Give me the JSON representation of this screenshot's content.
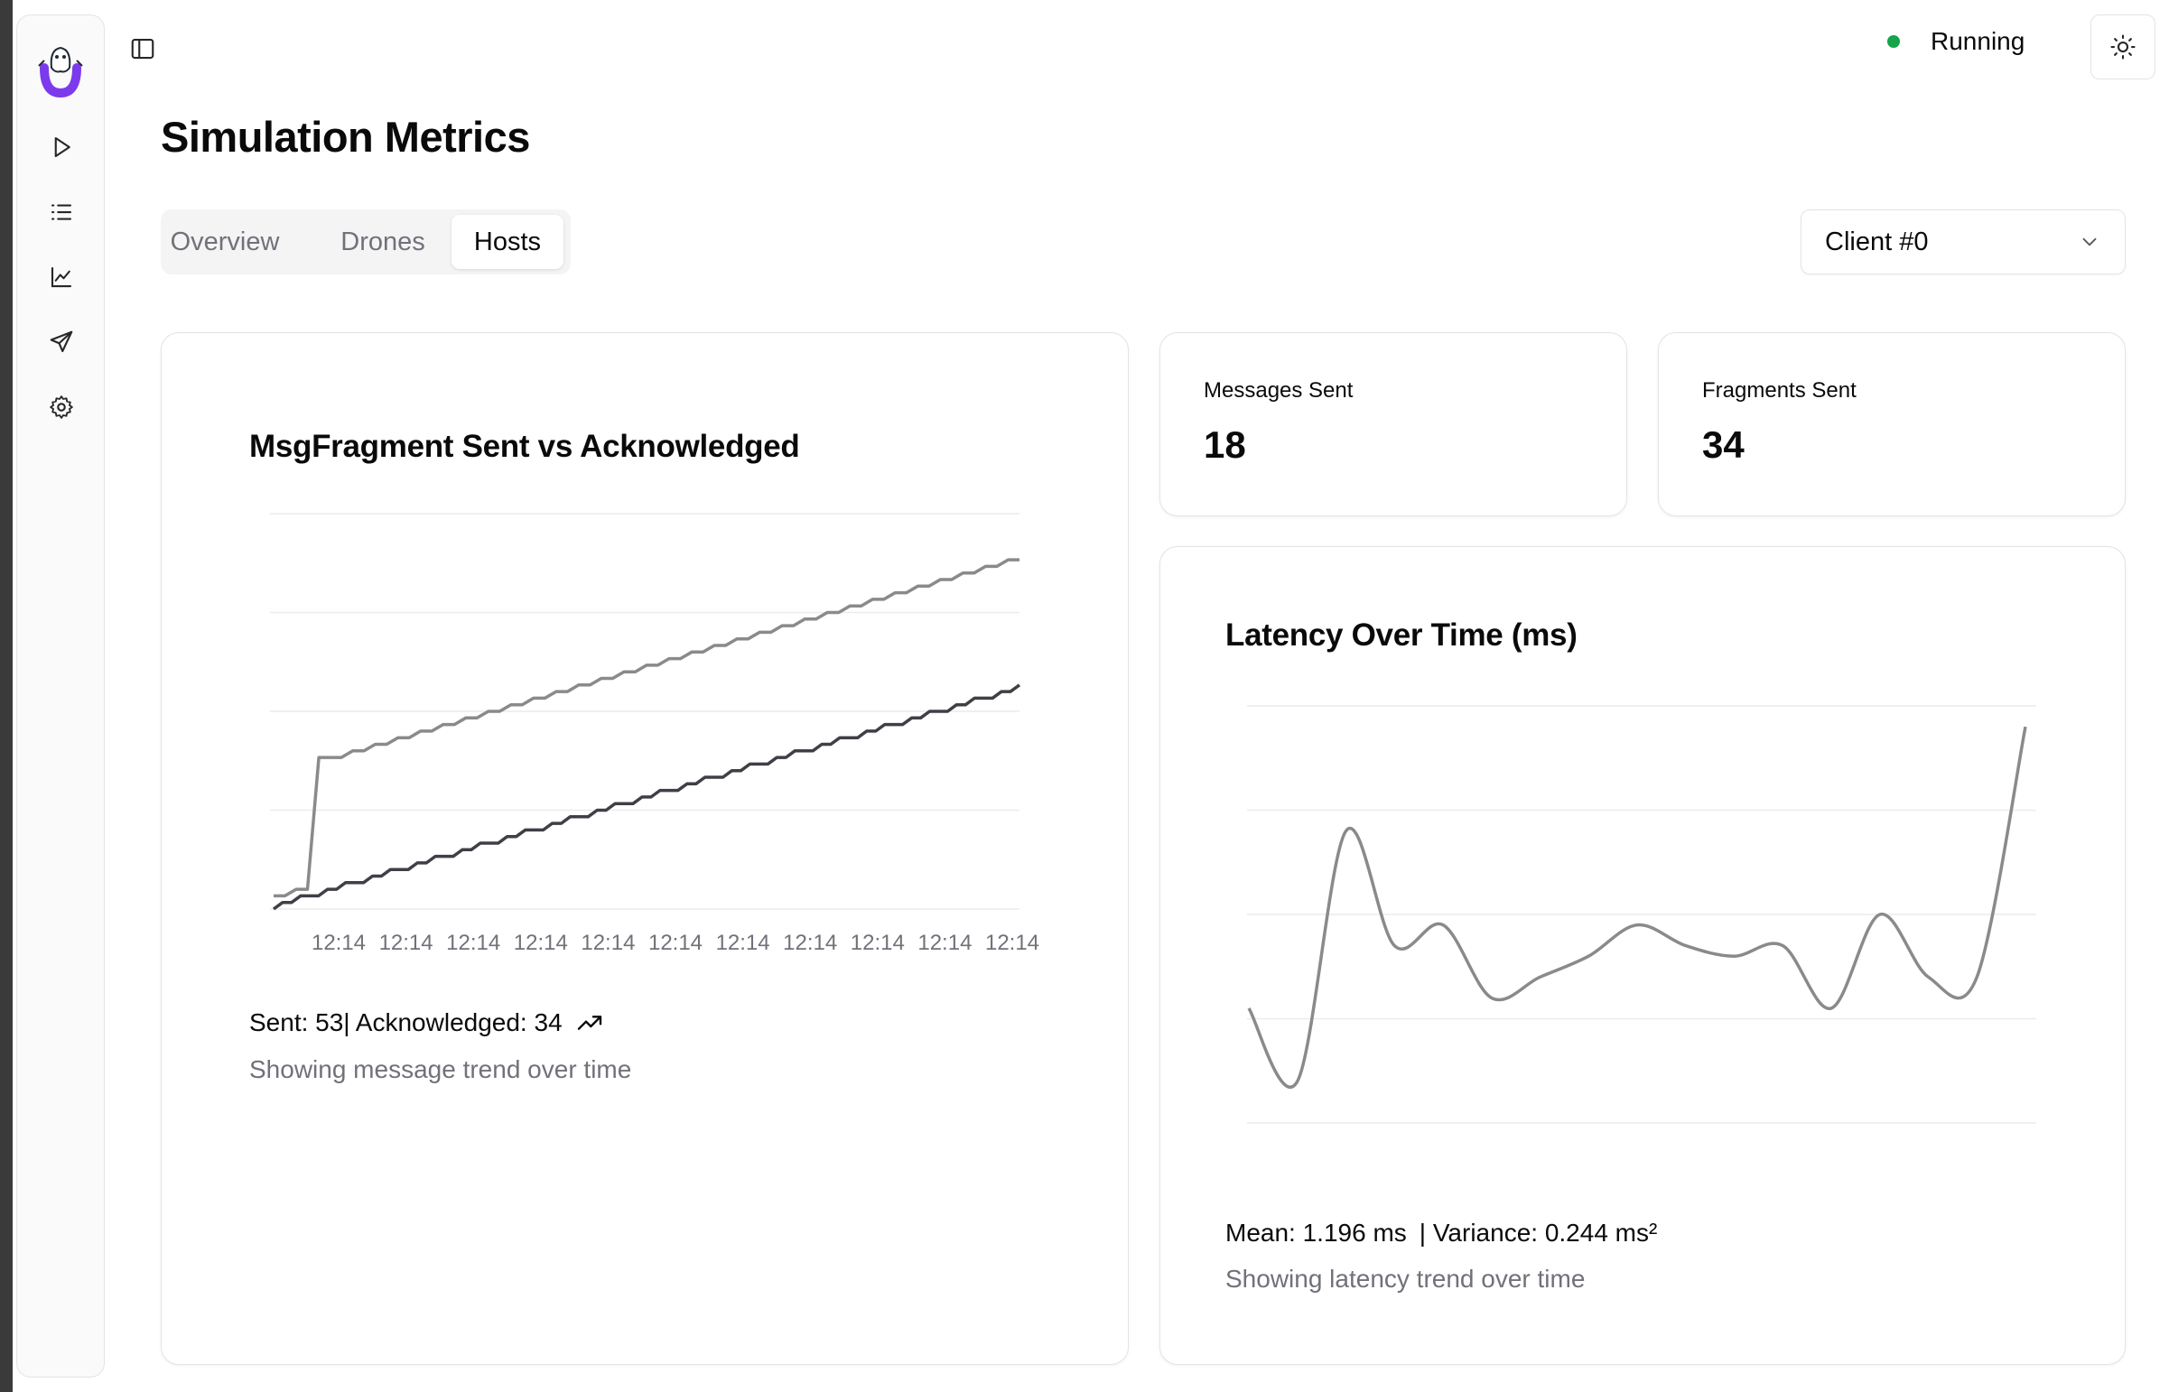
{
  "header": {
    "status_label": "Running",
    "status_color": "#16a34a"
  },
  "sidebar": {
    "icons": [
      "play-icon",
      "list-icon",
      "chart-line-icon",
      "send-icon",
      "gear-icon"
    ]
  },
  "page": {
    "title": "Simulation Metrics"
  },
  "tabs": [
    {
      "label": "Overview",
      "active": false
    },
    {
      "label": "Drones",
      "active": false
    },
    {
      "label": "Hosts",
      "active": true
    }
  ],
  "client_select": {
    "value": "Client #0"
  },
  "stats": {
    "messages_sent": {
      "label": "Messages Sent",
      "value": "18"
    },
    "fragments_sent": {
      "label": "Fragments Sent",
      "value": "34"
    }
  },
  "fragment_chart": {
    "title": "MsgFragment Sent vs Acknowledged",
    "summary": "Sent: 53| Acknowledged: 34",
    "subtitle": "Showing message trend over time",
    "tick_labels": [
      "12:14",
      "12:14",
      "12:14",
      "12:14",
      "12:14",
      "12:14",
      "12:14",
      "12:14",
      "12:14",
      "12:14",
      "12:14"
    ]
  },
  "latency_chart": {
    "title": "Latency Over Time (ms)",
    "mean_text": "Mean: 1.196 ms",
    "variance_text": "| Variance: 0.244 ms²",
    "subtitle": "Showing latency trend over time"
  },
  "chart_data": [
    {
      "type": "line",
      "title": "MsgFragment Sent vs Acknowledged",
      "categories": [
        "12:14",
        "12:14",
        "12:14",
        "12:14",
        "12:14",
        "12:14",
        "12:14",
        "12:14",
        "12:14",
        "12:14",
        "12:14"
      ],
      "grid": true,
      "ylim": [
        0,
        60
      ],
      "series": [
        {
          "name": "Sent",
          "color": "#8a8a8a",
          "values": [
            2,
            2,
            3,
            3,
            23,
            23,
            23,
            24,
            24,
            25,
            25,
            26,
            26,
            27,
            27,
            28,
            28,
            29,
            29,
            30,
            30,
            31,
            31,
            32,
            32,
            33,
            33,
            34,
            34,
            35,
            35,
            36,
            36,
            37,
            37,
            38,
            38,
            39,
            39,
            40,
            40,
            41,
            41,
            42,
            42,
            43,
            43,
            44,
            44,
            45,
            45,
            46,
            46,
            47,
            47,
            48,
            48,
            49,
            49,
            50,
            50,
            51,
            51,
            52,
            52,
            53,
            53
          ]
        },
        {
          "name": "Acknowledged",
          "color": "#3f3f46",
          "values": [
            0,
            1,
            1,
            2,
            2,
            2,
            3,
            3,
            4,
            4,
            4,
            5,
            5,
            6,
            6,
            6,
            7,
            7,
            8,
            8,
            8,
            9,
            9,
            10,
            10,
            10,
            11,
            11,
            12,
            12,
            12,
            13,
            13,
            14,
            14,
            14,
            15,
            15,
            16,
            16,
            16,
            17,
            17,
            18,
            18,
            18,
            19,
            19,
            20,
            20,
            20,
            21,
            21,
            22,
            22,
            22,
            23,
            23,
            24,
            24,
            24,
            25,
            25,
            26,
            26,
            26,
            27,
            27,
            28,
            28,
            28,
            29,
            29,
            30,
            30,
            30,
            31,
            31,
            32,
            32,
            32,
            33,
            33,
            34
          ]
        }
      ]
    },
    {
      "type": "line",
      "title": "Latency Over Time (ms)",
      "grid": true,
      "ylim": [
        0,
        4
      ],
      "series": [
        {
          "name": "Latency",
          "color": "#8a8a8a",
          "values": [
            1.1,
            0.4,
            2.8,
            1.7,
            1.9,
            1.2,
            1.4,
            1.6,
            1.9,
            1.7,
            1.6,
            1.7,
            1.1,
            2.0,
            1.4,
            1.4,
            3.8
          ]
        }
      ]
    }
  ]
}
